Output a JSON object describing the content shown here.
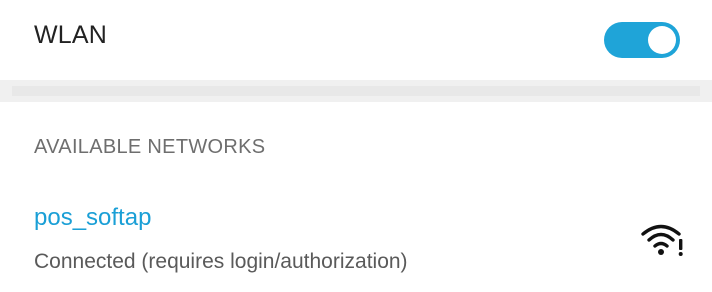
{
  "wlan": {
    "label": "WLAN",
    "enabled": true,
    "toggle_color": "#1fa4d8"
  },
  "available_networks": {
    "header": "AVAILABLE NETWORKS",
    "items": [
      {
        "name": "pos_softap",
        "status": "Connected (requires login/authorization)",
        "icon": "wifi-signal-warning-icon"
      }
    ]
  }
}
